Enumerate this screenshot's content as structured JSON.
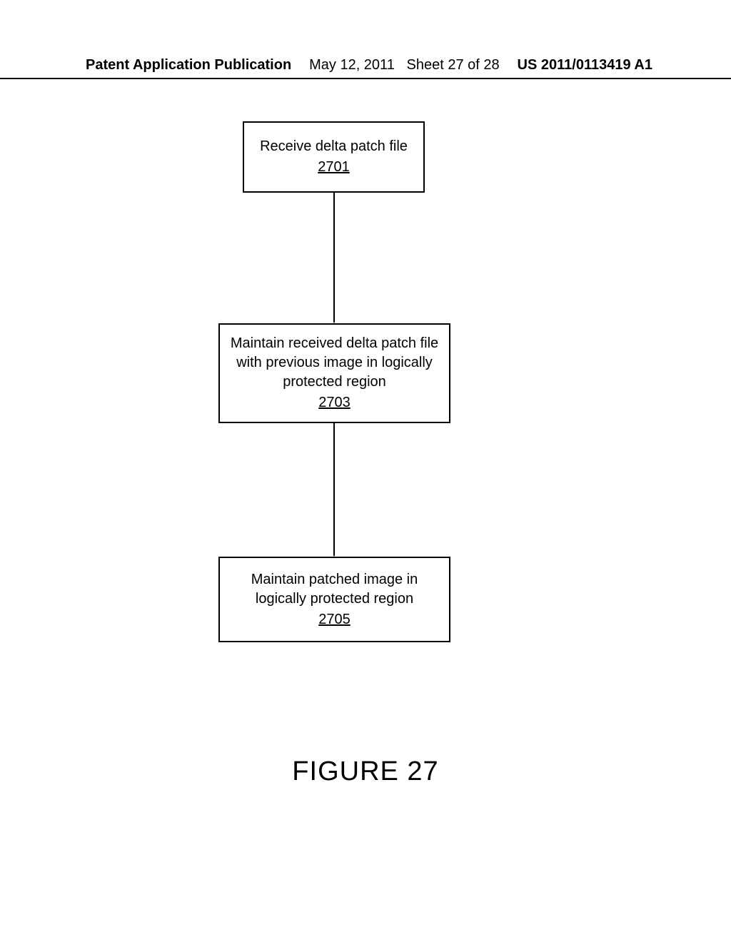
{
  "header": {
    "left": "Patent Application Publication",
    "center_date": "May 12, 2011",
    "center_sheet": "Sheet 27 of 28",
    "right": "US 2011/0113419 A1"
  },
  "boxes": {
    "b1": {
      "text": "Receive delta patch file",
      "ref": "2701"
    },
    "b2": {
      "text": "Maintain received delta patch file with previous image in logically protected region",
      "ref": "2703"
    },
    "b3": {
      "text": "Maintain patched image in logically protected region",
      "ref": "2705"
    }
  },
  "figure_label": "FIGURE 27",
  "chart_data": {
    "type": "table",
    "description": "Flowchart with three sequential steps connected by downward arrows",
    "nodes": [
      {
        "id": "2701",
        "label": "Receive delta patch file"
      },
      {
        "id": "2703",
        "label": "Maintain received delta patch file with previous image in logically protected region"
      },
      {
        "id": "2705",
        "label": "Maintain patched image in logically protected region"
      }
    ],
    "edges": [
      {
        "from": "2701",
        "to": "2703"
      },
      {
        "from": "2703",
        "to": "2705"
      }
    ]
  }
}
